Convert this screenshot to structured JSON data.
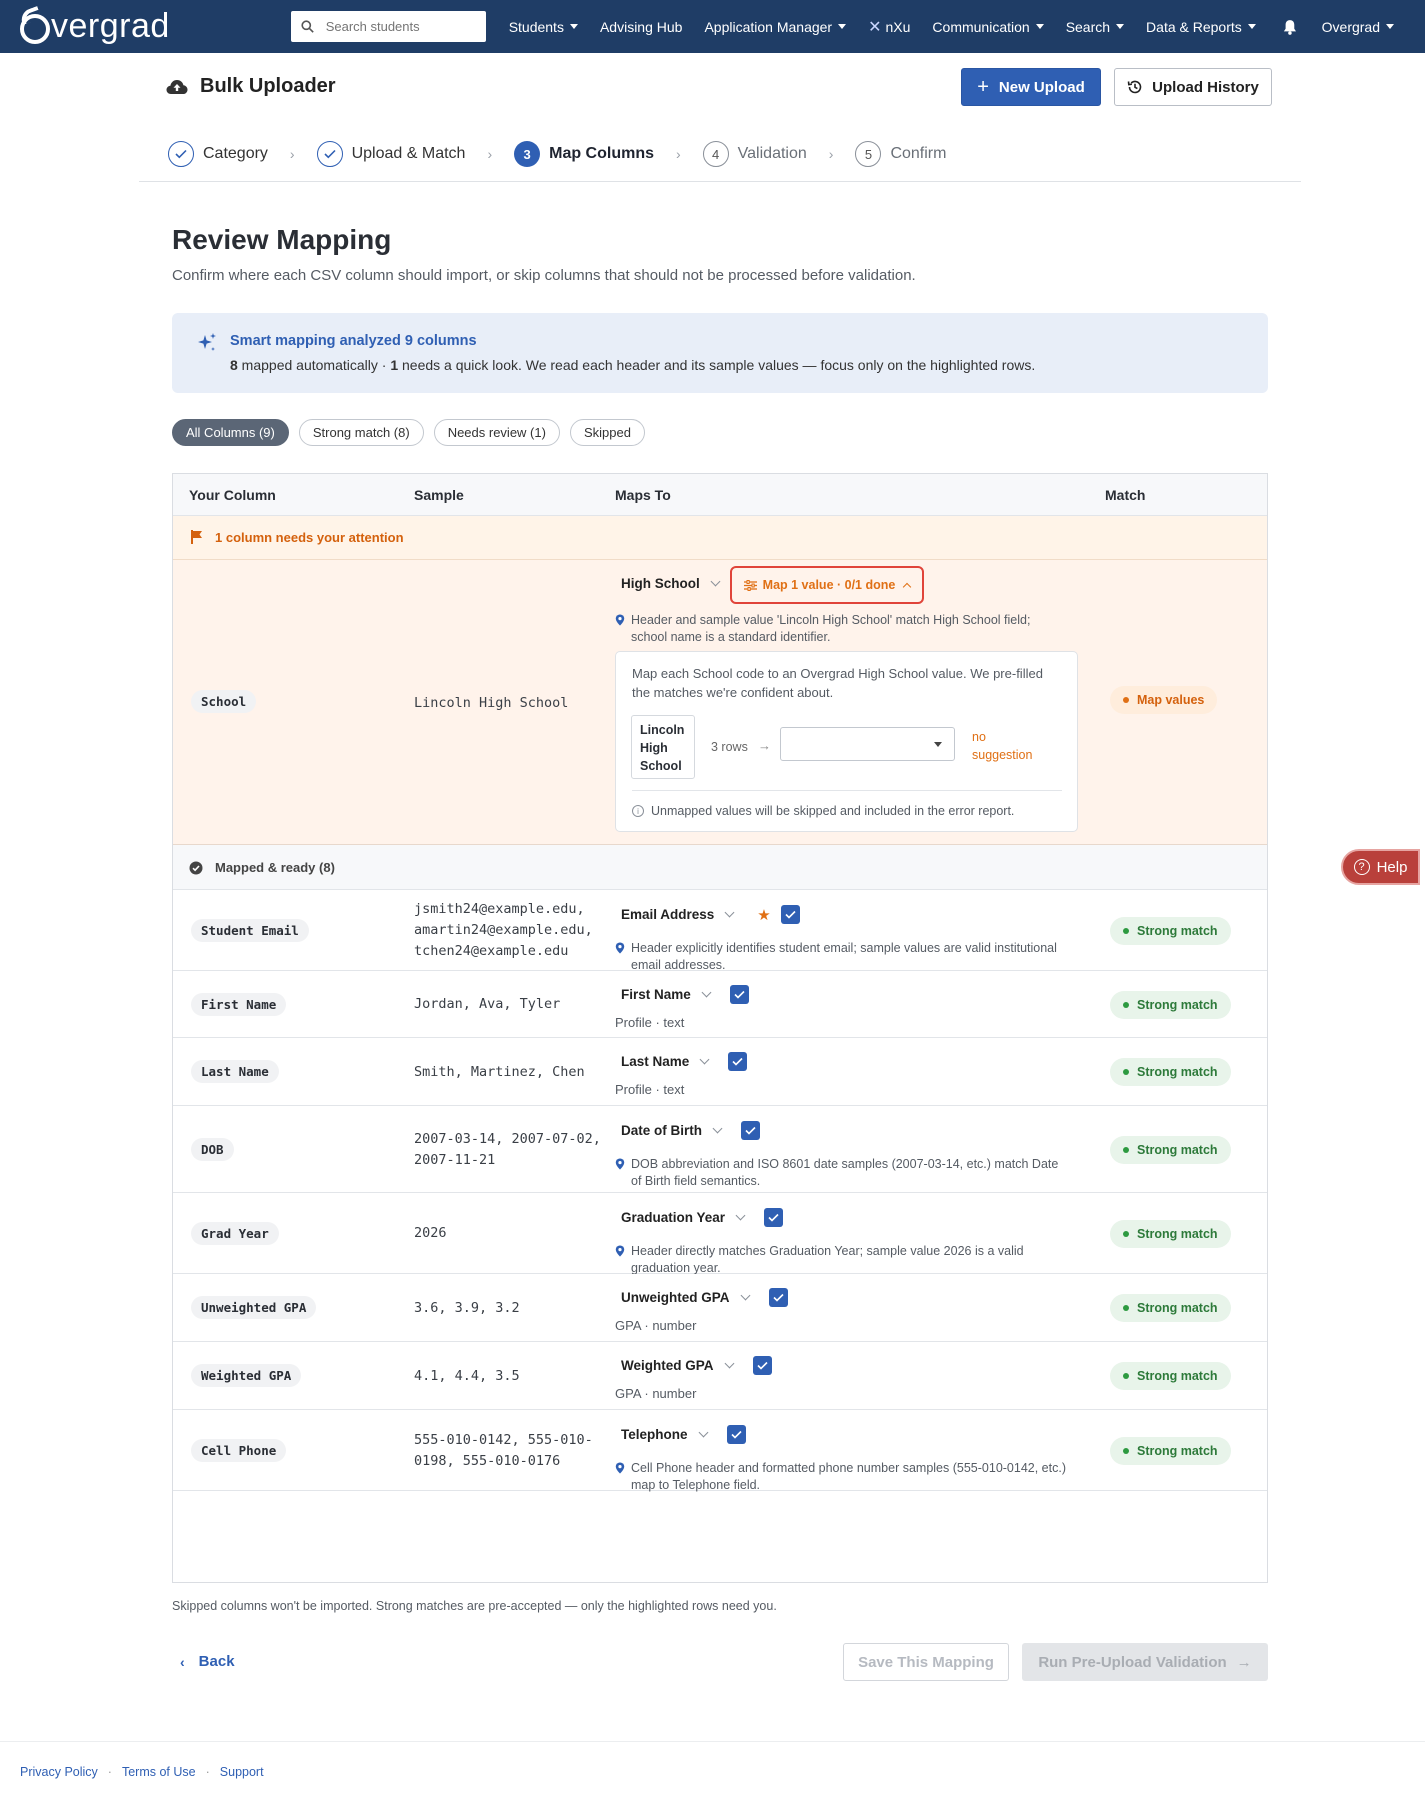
{
  "nav": {
    "brand": "vergrad",
    "search_placeholder": "Search students",
    "items": [
      {
        "label": "Students",
        "has_caret": true
      },
      {
        "label": "Advising Hub",
        "has_caret": false
      },
      {
        "label": "Application Manager",
        "has_caret": true
      },
      {
        "label": "nXu",
        "has_caret": false
      },
      {
        "label": "Communication",
        "has_caret": true
      },
      {
        "label": "Search",
        "has_caret": true
      },
      {
        "label": "Data & Reports",
        "has_caret": true
      }
    ],
    "account": "Overgrad"
  },
  "header": {
    "title": "Bulk Uploader",
    "new_upload": "New Upload",
    "upload_history": "Upload History"
  },
  "stepper": [
    {
      "num": "",
      "label": "Category",
      "state": "done"
    },
    {
      "num": "",
      "label": "Upload & Match",
      "state": "done"
    },
    {
      "num": "3",
      "label": "Map Columns",
      "state": "active"
    },
    {
      "num": "4",
      "label": "Validation",
      "state": "todo"
    },
    {
      "num": "5",
      "label": "Confirm",
      "state": "todo"
    }
  ],
  "main": {
    "title": "Review Mapping",
    "subtitle": "Confirm where each CSV column should import, or skip columns that should not be processed before validation."
  },
  "banner": {
    "title": "Smart mapping analyzed 9 columns",
    "mapped_count": "8",
    "mapped_text": " mapped automatically · ",
    "review_count": "1",
    "review_text": " needs a quick look. We read each header and its sample values — focus only on the highlighted rows."
  },
  "filters": [
    "All Columns (9)",
    "Strong match (8)",
    "Needs review (1)",
    "Skipped"
  ],
  "table": {
    "headers": {
      "col": "Your Column",
      "sample": "Sample",
      "maps": "Maps To",
      "match": "Match"
    },
    "attention": "1 column needs your attention",
    "school": {
      "column": "School",
      "sample": "Lincoln High School",
      "field": "High School",
      "map_values": "Map 1 value · 0/1 done",
      "explain": "Header and sample value 'Lincoln High School' match High School field; school name is a standard identifier.",
      "badge": "Map values",
      "card_intro": "Map each School code to an Overgrad High School value. We pre-filled the matches we're confident about.",
      "card_source": "Lincoln High School",
      "card_rows": "3 rows",
      "card_nosug": "no suggestion",
      "card_note": "Unmapped values will be skipped and included in the error report."
    },
    "ready": "Mapped & ready (8)",
    "rows": [
      {
        "column": "Student Email",
        "sample": "jsmith24@example.edu,\namartin24@example.edu,\ntchen24@example.edu",
        "field": "Email Address",
        "star": true,
        "explain": "Header explicitly identifies student email; sample values are valid institutional email addresses.",
        "meta": "",
        "badge": "Strong match"
      },
      {
        "column": "First Name",
        "sample": "Jordan, Ava, Tyler",
        "field": "First Name",
        "star": false,
        "explain": "",
        "meta": "Profile · text",
        "badge": "Strong match"
      },
      {
        "column": "Last Name",
        "sample": "Smith, Martinez, Chen",
        "field": "Last Name",
        "star": false,
        "explain": "",
        "meta": "Profile · text",
        "badge": "Strong match"
      },
      {
        "column": "DOB",
        "sample": "2007-03-14, 2007-07-02,\n2007-11-21",
        "field": "Date of Birth",
        "star": false,
        "explain": "DOB abbreviation and ISO 8601 date samples (2007-03-14, etc.) match Date of Birth field semantics.",
        "meta": "",
        "badge": "Strong match"
      },
      {
        "column": "Grad Year",
        "sample": "2026",
        "field": "Graduation Year",
        "star": false,
        "explain": "Header directly matches Graduation Year; sample value 2026 is a valid graduation year.",
        "meta": "",
        "badge": "Strong match"
      },
      {
        "column": "Unweighted GPA",
        "sample": "3.6, 3.9, 3.2",
        "field": "Unweighted GPA",
        "star": false,
        "explain": "",
        "meta": "GPA · number",
        "badge": "Strong match"
      },
      {
        "column": "Weighted GPA",
        "sample": "4.1, 4.4, 3.5",
        "field": "Weighted GPA",
        "star": false,
        "explain": "",
        "meta": "GPA · number",
        "badge": "Strong match"
      },
      {
        "column": "Cell Phone",
        "sample": "555-010-0142, 555-010-\n0198, 555-010-0176",
        "field": "Telephone",
        "star": false,
        "explain": "Cell Phone header and formatted phone number samples (555-010-0142, etc.) map to Telephone field.",
        "meta": "",
        "badge": "Strong match"
      }
    ]
  },
  "footnote": "Skipped columns won't be imported. Strong matches are pre-accepted — only the highlighted rows need you.",
  "actions": {
    "back": "Back",
    "save": "Save This Mapping",
    "run": "Run Pre-Upload Validation"
  },
  "footer": [
    "Privacy Policy",
    "Terms of Use",
    "Support"
  ],
  "help": "Help",
  "colors": {
    "nav": "#1f3d66",
    "primary": "#2f5fb3",
    "warn": "#e07015",
    "success": "#2d7a3a"
  }
}
